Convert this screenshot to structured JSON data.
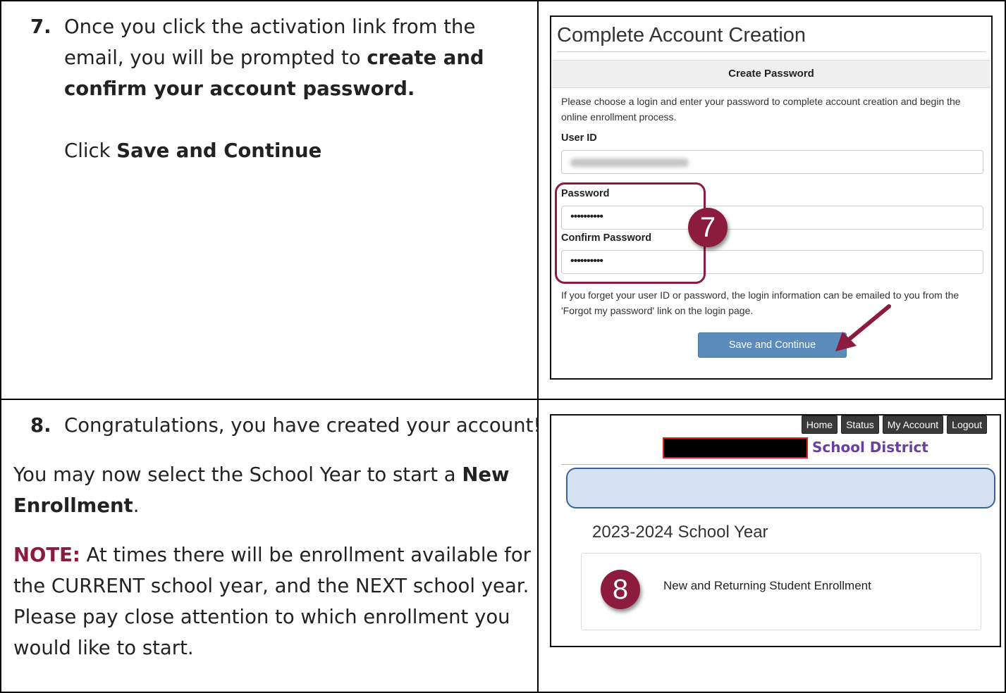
{
  "step7": {
    "number": "7.",
    "line1": "Once you click the activation link from the",
    "line2_plain": "email, you will be prompted to ",
    "line2_bold": "create and",
    "line3_bold": "confirm your account password.",
    "click_plain": "Click ",
    "click_bold": "Save and Continue"
  },
  "step8": {
    "number": "8.",
    "line1": "Congratulations, you have created your account!",
    "p2_plain": "You may now select the School Year to start a ",
    "p2_bold1": "New",
    "p2_bold2": "Enrollment",
    "p2_end": ".",
    "note_label": "NOTE:",
    "note_l1": " At times there will be enrollment available for",
    "note_l2": "the CURRENT school year, and the NEXT school year.",
    "note_l3": "Please pay close attention to which enrollment you",
    "note_l4": "would like to start."
  },
  "account_form": {
    "title": "Complete Account Creation",
    "section_header": "Create Password",
    "description": "Please choose a login and enter your password to complete account creation and begin the online enrollment process.",
    "user_id_label": "User ID",
    "password_label": "Password",
    "password_value": "••••••••••",
    "confirm_label": "Confirm Password",
    "confirm_value": "••••••••••",
    "forgot_text": "If you forget your user ID or password, the login information can be emailed to you from the 'Forgot my password' link on the login page.",
    "save_button": "Save and Continue",
    "badge": "7"
  },
  "portal": {
    "nav": [
      "Home",
      "Status",
      "My Account",
      "Logout"
    ],
    "district_suffix": "School District",
    "school_year": "2023-2024 School Year",
    "enrollment_link": "New and Returning Student Enrollment",
    "badge": "8"
  },
  "colors": {
    "accent": "#8b1c3d",
    "button_blue": "#5a8bbb",
    "district_purple": "#6b3fa0",
    "banner_blue": "#d6e2f2"
  }
}
